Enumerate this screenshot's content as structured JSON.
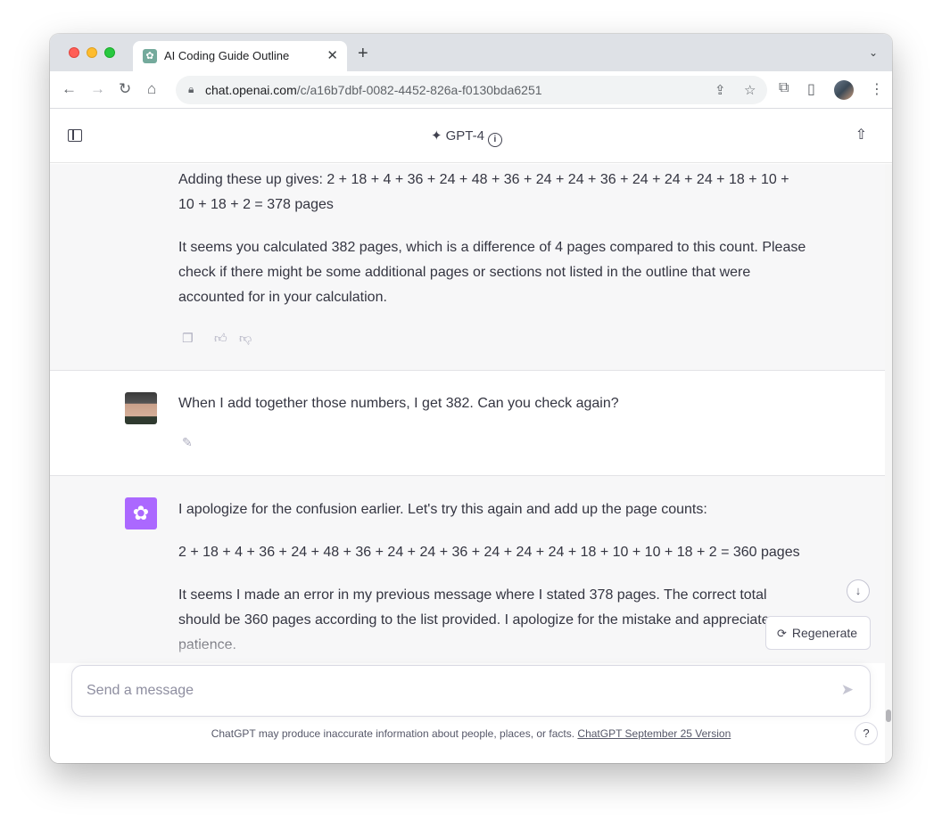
{
  "browser": {
    "tab_title": "AI Coding Guide Outline",
    "tab_close": "✕",
    "new_tab": "+",
    "tab_menu": "⌄",
    "url_host": "chat.openai.com",
    "url_path": "/c/a16b7dbf-0082-4452-826a-f0130bda6251",
    "icons": [
      "back-icon",
      "forward-icon",
      "reload-icon",
      "home-icon",
      "lock-icon",
      "share-page-icon",
      "bookmark-star-icon",
      "extensions-icon",
      "side-panel-icon",
      "profile-avatar",
      "chrome-menu-icon"
    ]
  },
  "header": {
    "model_name": "GPT-4",
    "info_glyph": "i"
  },
  "messages": [
    {
      "role": "assistant",
      "paragraphs": [
        "Adding these up gives: 2 + 18 + 4 + 36 + 24 + 48 + 36 + 24 + 24 + 36 + 24 + 24 + 24 + 18 + 10 + 10 + 18 + 2 = 378 pages",
        "It seems you calculated 382 pages, which is a difference of 4 pages compared to this count. Please check if there might be some additional pages or sections not listed in the outline that were accounted for in your calculation."
      ],
      "actions": [
        "copy-icon",
        "thumbs-up-icon",
        "thumbs-down-icon"
      ]
    },
    {
      "role": "user",
      "paragraphs": [
        "When I add together those numbers, I get 382. Can you check again?"
      ],
      "actions": [
        "edit-icon"
      ]
    },
    {
      "role": "assistant",
      "paragraphs": [
        "I apologize for the confusion earlier. Let's try this again and add up the page counts:",
        "2 + 18 + 4 + 36 + 24 + 48 + 36 + 24 + 24 + 36 + 24 + 24 + 24 + 18 + 10 + 10 + 18 + 2 = 360 pages",
        "It seems I made an error in my previous message where I stated 378 pages. The correct total should be 360 pages according to the list provided. I apologize for the mistake and appreciate your patience."
      ]
    }
  ],
  "controls": {
    "regenerate_label": "Regenerate",
    "scroll_down_glyph": "↓"
  },
  "composer": {
    "placeholder": "Send a message",
    "send_glyph": "➤"
  },
  "footer": {
    "disclaimer": "ChatGPT may produce inaccurate information about people, places, or facts.",
    "version_link": "ChatGPT September 25 Version",
    "help_glyph": "?"
  },
  "colors": {
    "assistant_bg": "#f7f7f8",
    "gpt4_avatar": "#ab68ff",
    "text": "#343541"
  }
}
